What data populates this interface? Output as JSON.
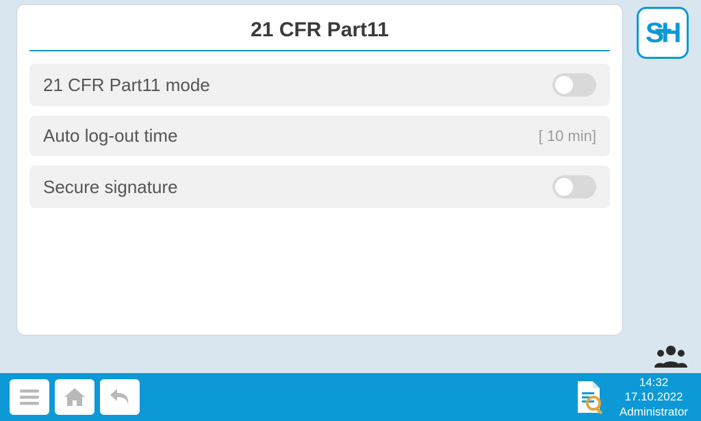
{
  "header": {
    "title": "21 CFR Part11"
  },
  "brand": {
    "logo_letters": "SH"
  },
  "settings": {
    "row0": {
      "label": "21 CFR Part11 mode"
    },
    "row1": {
      "label": "Auto log-out time",
      "value": "[ 10 min]"
    },
    "row2": {
      "label": "Secure signature"
    }
  },
  "toggles": {
    "cfr_mode": {
      "on": false
    },
    "secure_sig": {
      "on": false
    }
  },
  "footer": {
    "time": "14:32",
    "date": "17.10.2022",
    "user": "Administrator"
  },
  "colors": {
    "accent": "#0d99d6"
  }
}
